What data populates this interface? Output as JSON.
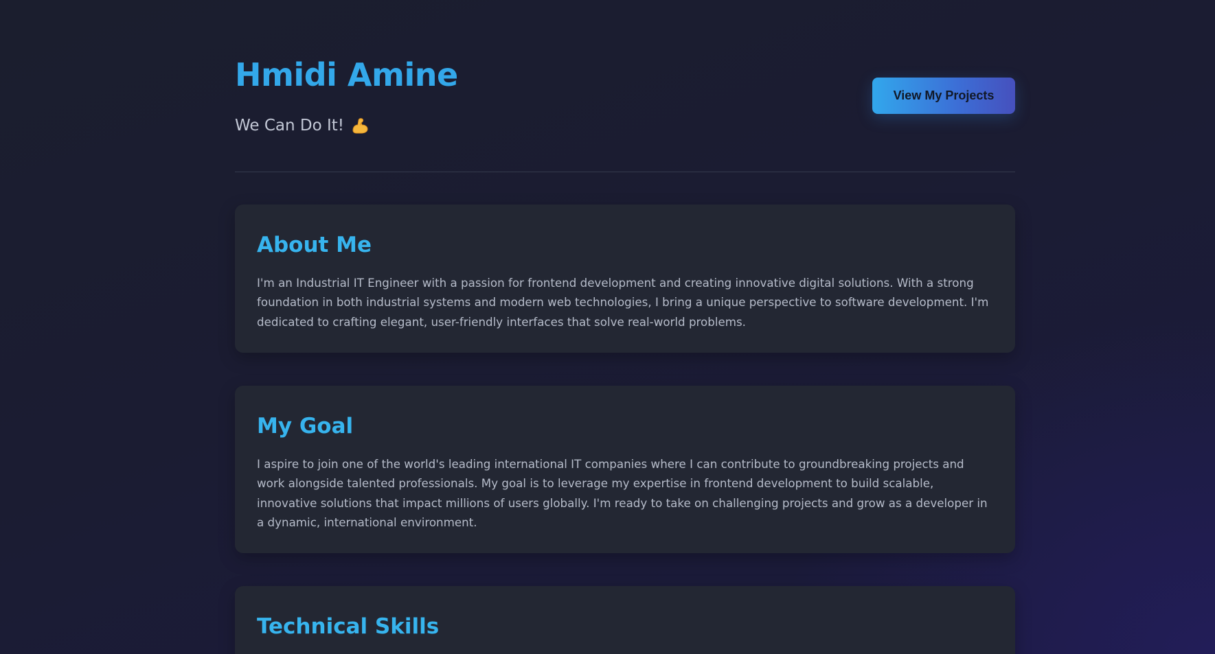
{
  "header": {
    "name": "Hmidi Amine",
    "tagline": "We Can Do It!",
    "tagline_icon": "flexed-biceps-icon",
    "projects_button": "View My Projects"
  },
  "sections": {
    "about": {
      "title": "About Me",
      "text": "I'm an Industrial IT Engineer with a passion for frontend development and creating innovative digital solutions. With a strong foundation in both industrial systems and modern web technologies, I bring a unique perspective to software development. I'm dedicated to crafting elegant, user-friendly interfaces that solve real-world problems."
    },
    "goal": {
      "title": "My Goal",
      "text": "I aspire to join one of the world's leading international IT companies where I can contribute to groundbreaking projects and work alongside talented professionals. My goal is to leverage my expertise in frontend development to build scalable, innovative solutions that impact millions of users globally. I'm ready to take on challenging projects and grow as a developer in a dynamic, international environment."
    },
    "skills": {
      "title": "Technical Skills"
    }
  },
  "colors": {
    "accent": "#33a8ea",
    "heading": "#37b4ee",
    "background": "#1b1c32",
    "card": "#232733",
    "body_text": "#b6bcca"
  }
}
